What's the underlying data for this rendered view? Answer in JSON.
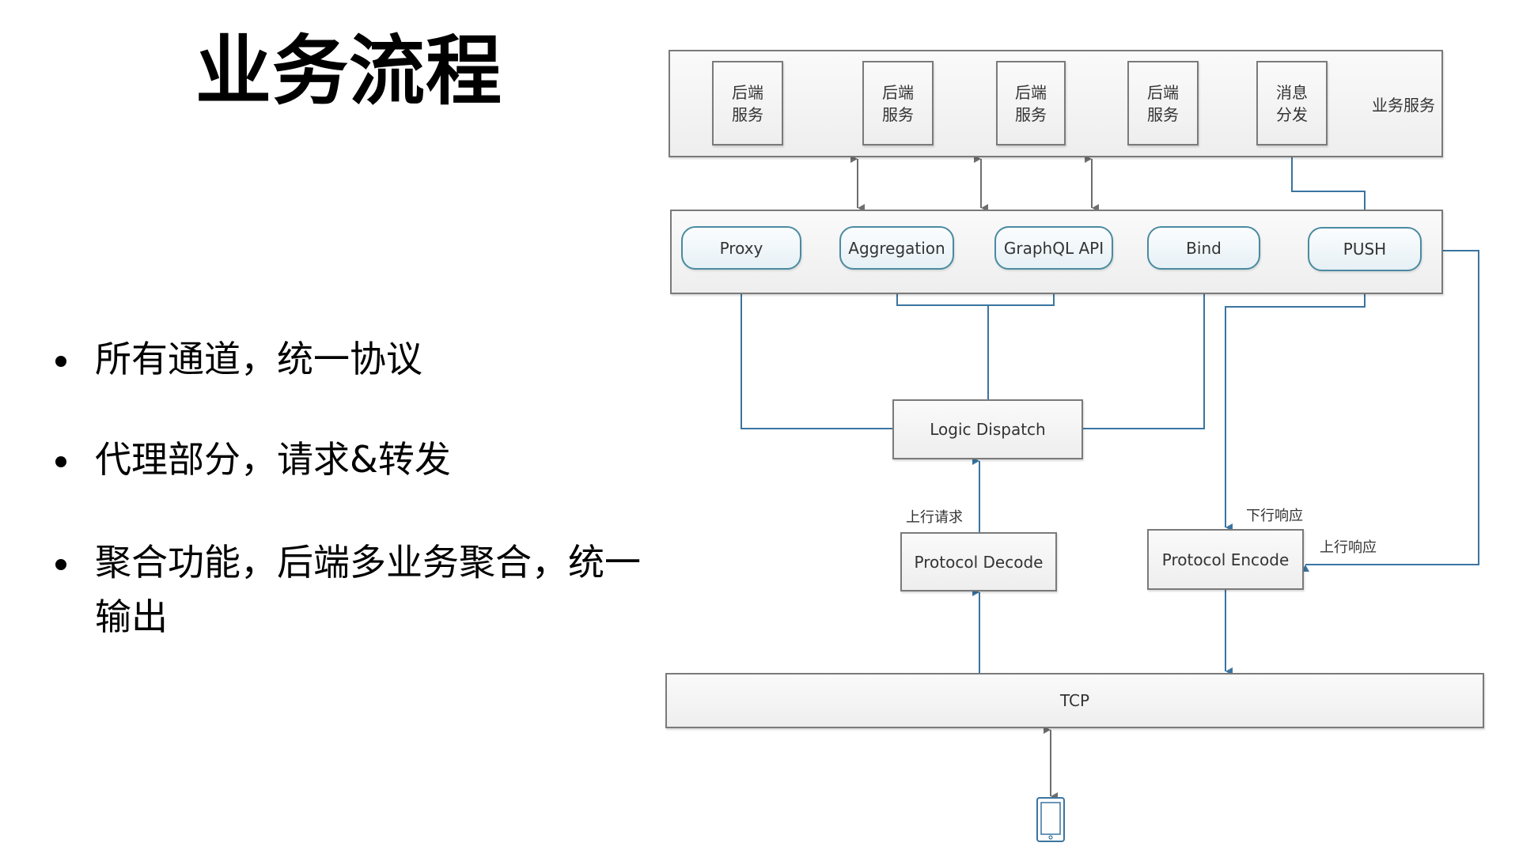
{
  "slide": {
    "title": "业务流程",
    "bullets": [
      "所有通道，统一协议",
      "代理部分，请求&转发",
      "聚合功能，后端多业务聚合，统一输出"
    ]
  },
  "diagram": {
    "business_layer": {
      "label": "业务服务",
      "services": [
        {
          "line1": "后端",
          "line2": "服务"
        },
        {
          "line1": "后端",
          "line2": "服务"
        },
        {
          "line1": "后端",
          "line2": "服务"
        },
        {
          "line1": "后端",
          "line2": "服务"
        },
        {
          "line1": "消息",
          "line2": "分发"
        }
      ]
    },
    "gateway_layer": {
      "modules": [
        "Proxy",
        "Aggregation",
        "GraphQL API",
        "Bind",
        "PUSH"
      ]
    },
    "logic_dispatch": "Logic Dispatch",
    "protocol_decode": "Protocol Decode",
    "protocol_encode": "Protocol Encode",
    "tcp": "TCP",
    "edge_labels": {
      "upstream_request": "上行请求",
      "downstream_response": "下行响应",
      "upstream_response": "上行响应"
    },
    "client_icon": "mobile-phone-icon",
    "colors": {
      "flow_line": "#3a74a0",
      "gray_line": "#6e6e6e",
      "box_border": "#7a7a7a",
      "pill_border": "#4a8aa0"
    }
  }
}
